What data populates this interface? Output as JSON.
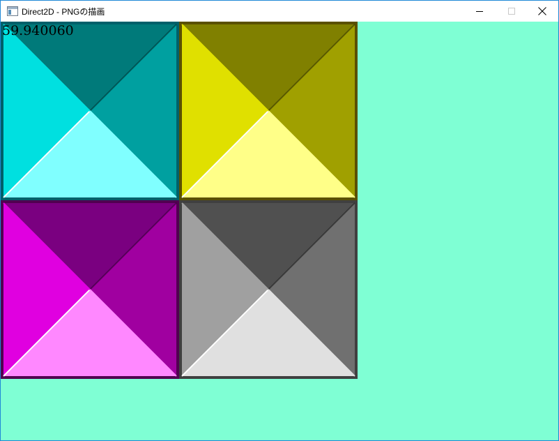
{
  "window": {
    "title": "Direct2D - PNGの描画",
    "icon": "app-window-icon",
    "buttons": {
      "minimize": "minimize-icon",
      "maximize": "maximize-icon",
      "close": "close-icon"
    }
  },
  "client": {
    "background": "#7fffd4",
    "fps_text": "59.940060",
    "tiles": [
      {
        "name": "cyan",
        "border": "#00606a",
        "top": "#007a7a",
        "left": "#00e0e0",
        "right": "#00a0a0",
        "bottom": "#80ffff"
      },
      {
        "name": "yellow",
        "border": "#5a5000",
        "top": "#808000",
        "left": "#e0e000",
        "right": "#a0a000",
        "bottom": "#ffff88"
      },
      {
        "name": "magenta",
        "border": "#500050",
        "top": "#7a0080",
        "left": "#e000e0",
        "right": "#a000a0",
        "bottom": "#ff88ff"
      },
      {
        "name": "gray",
        "border": "#404040",
        "top": "#505050",
        "left": "#a0a0a0",
        "right": "#707070",
        "bottom": "#e0e0e0"
      }
    ]
  }
}
